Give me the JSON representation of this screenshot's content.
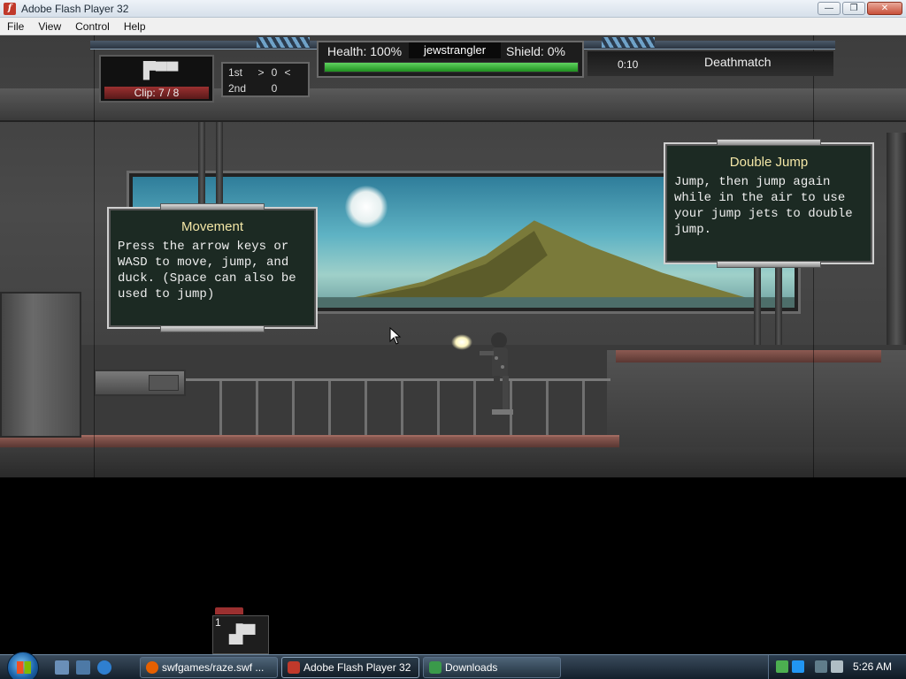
{
  "window": {
    "title": "Adobe Flash Player 32",
    "minimize": "—",
    "maximize": "❐",
    "close": "✕"
  },
  "menu": [
    "File",
    "View",
    "Control",
    "Help"
  ],
  "hud": {
    "clip_label": "Clip: 7 / 8",
    "ranks": [
      {
        "pos": "1st",
        "marker_left": ">",
        "score": "0",
        "marker_right": "<"
      },
      {
        "pos": "2nd",
        "marker_left": "",
        "score": "0",
        "marker_right": ""
      }
    ],
    "health_label": "Health: 100%",
    "health_fraction": 1.0,
    "player_name": "jewstrangler",
    "shield_label": "Shield: 0%",
    "timer": "0:10",
    "mode": "Deathmatch"
  },
  "panels": {
    "movement": {
      "title": "Movement",
      "body": "Press the arrow keys or\nWASD to move, jump, and\nduck. (Space can also be\nused to jump)"
    },
    "double_jump": {
      "title": "Double Jump",
      "body": "Jump, then jump again\nwhile in the air to use\nyour jump jets to double\njump."
    }
  },
  "weapon_slot": {
    "number": "1",
    "icon": "pistol-icon"
  },
  "taskbar": {
    "tasks": [
      {
        "label": "swfgames/raze.swf ...",
        "icon": "firefox-icon",
        "color": "#e66000"
      },
      {
        "label": "Adobe Flash Player 32",
        "icon": "flash-icon",
        "color": "#c0392b"
      },
      {
        "label": "Downloads",
        "icon": "folder-icon",
        "color": "#3a9a4a"
      }
    ],
    "clock": "5:26 AM"
  },
  "colors": {
    "health": "#2fb02f",
    "clip": "#9b3030",
    "panel_title": "#f3e6a6"
  }
}
